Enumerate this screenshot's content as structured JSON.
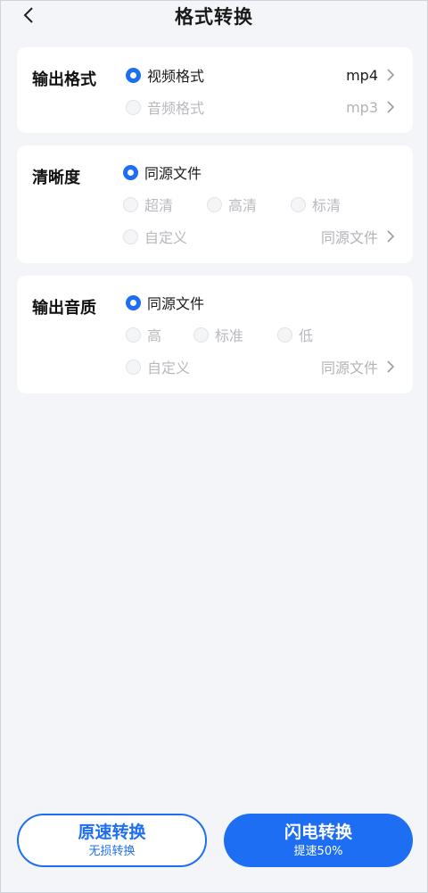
{
  "header": {
    "title": "格式转换"
  },
  "output_format": {
    "title": "输出格式",
    "options": [
      {
        "label": "视频格式",
        "value": "mp4",
        "checked": true
      },
      {
        "label": "音频格式",
        "value": "mp3",
        "checked": false
      }
    ]
  },
  "clarity": {
    "title": "清晰度",
    "option_source": "同源文件",
    "option_ultra": "超清",
    "option_high": "高清",
    "option_standard": "标清",
    "option_custom": "自定义",
    "custom_value": "同源文件",
    "selected": "同源文件"
  },
  "audio_quality": {
    "title": "输出音质",
    "option_source": "同源文件",
    "option_high": "高",
    "option_standard": "标准",
    "option_low": "低",
    "option_custom": "自定义",
    "custom_value": "同源文件",
    "selected": "同源文件"
  },
  "actions": {
    "normal_main": "原速转换",
    "normal_sub": "无损转换",
    "flash_main": "闪电转换",
    "flash_sub": "提速50%"
  },
  "colors": {
    "accent": "#1e6ef4",
    "background": "#f3f5f9",
    "card": "#ffffff",
    "disabled_text": "#b7b9bd"
  },
  "icons": {
    "back": "chevron-left-icon",
    "forward": "chevron-right-icon"
  }
}
